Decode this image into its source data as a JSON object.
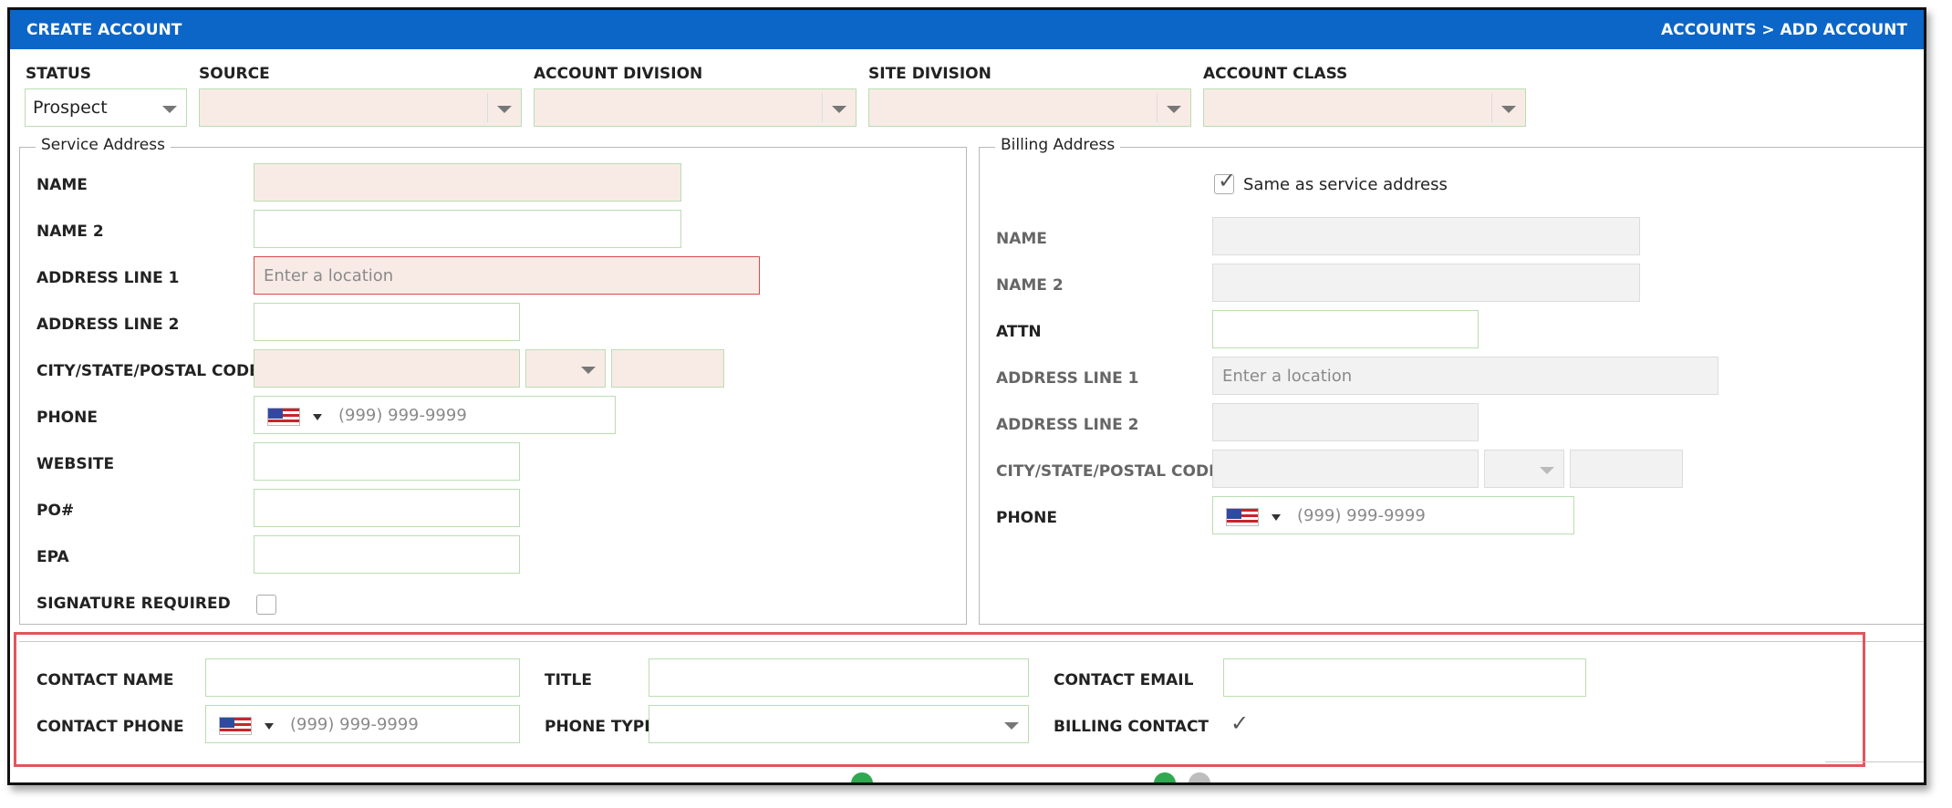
{
  "header": {
    "title": "CREATE ACCOUNT",
    "breadcrumb": "ACCOUNTS > ADD ACCOUNT"
  },
  "top": {
    "status_label": "STATUS",
    "status_value": "Prospect",
    "source_label": "SOURCE",
    "account_division_label": "ACCOUNT DIVISION",
    "site_division_label": "SITE DIVISION",
    "account_class_label": "ACCOUNT CLASS"
  },
  "service": {
    "legend": "Service Address",
    "name_label": "NAME",
    "name2_label": "NAME 2",
    "address1_label": "ADDRESS LINE 1",
    "address1_placeholder": "Enter a location",
    "address2_label": "ADDRESS LINE 2",
    "city_label": "CITY/STATE/POSTAL CODE",
    "phone_label": "PHONE",
    "phone_placeholder": "(999) 999-9999",
    "website_label": "WEBSITE",
    "po_label": "PO#",
    "epa_label": "EPA",
    "signature_label": "SIGNATURE REQUIRED"
  },
  "billing": {
    "legend": "Billing Address",
    "same_label": "Same as service address",
    "name_label": "NAME",
    "name2_label": "NAME 2",
    "attn_label": "ATTN",
    "address1_label": "ADDRESS LINE 1",
    "address1_placeholder": "Enter a location",
    "address2_label": "ADDRESS LINE 2",
    "city_label": "CITY/STATE/POSTAL CODE",
    "phone_label": "PHONE",
    "phone_placeholder": "(999) 999-9999"
  },
  "contact": {
    "name_label": "CONTACT NAME",
    "title_label": "TITLE",
    "email_label": "CONTACT EMAIL",
    "phone_label": "CONTACT PHONE",
    "phone_placeholder": "(999) 999-9999",
    "phone_type_label": "PHONE TYPE",
    "billing_contact_label": "BILLING CONTACT"
  },
  "icons": {
    "flag": "us-flag-icon",
    "check": "checkmark-icon",
    "caret": "chevron-down-icon"
  },
  "colors": {
    "header": "#0b66c8",
    "highlight_border": "#e0565b",
    "required_fill": "#f8ebe6",
    "valid_border": "#b9deb0"
  }
}
